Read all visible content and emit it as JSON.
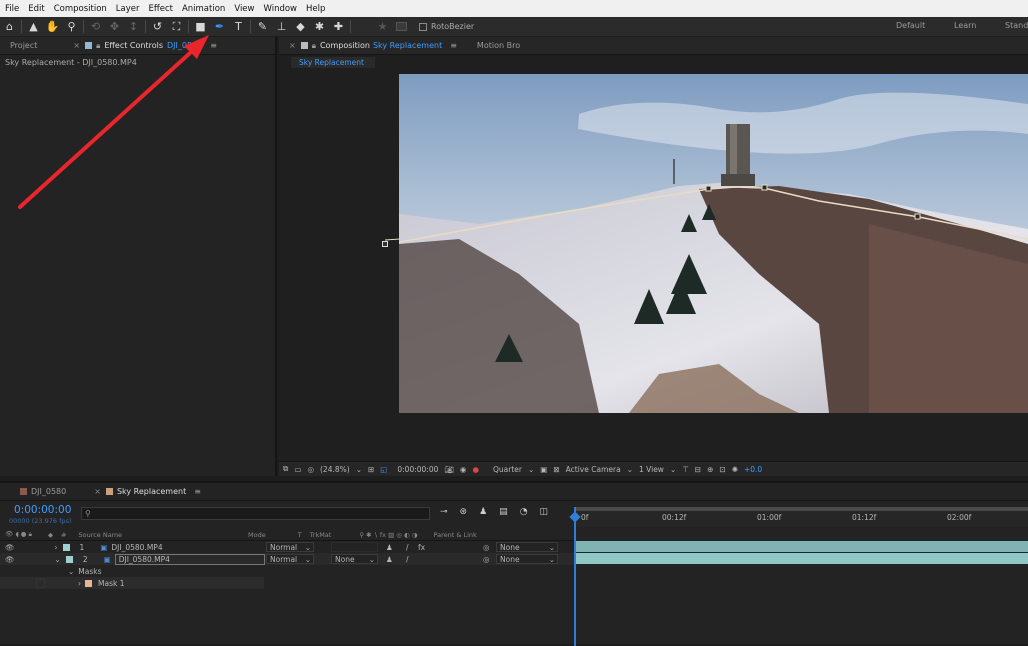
{
  "menu": [
    "File",
    "Edit",
    "Composition",
    "Layer",
    "Effect",
    "Animation",
    "View",
    "Window",
    "Help"
  ],
  "toolbar": {
    "tools": [
      "home-icon",
      "selection-icon",
      "hand-icon",
      "zoom-icon",
      "orbit-icon",
      "move-icon",
      "pan-icon",
      "rotate-icon",
      "anchor-icon",
      "rectangle-icon",
      "pen-icon",
      "type-icon",
      "brush-icon",
      "clone-stamp-icon",
      "eraser-icon",
      "roto-brush-icon",
      "puppet-icon"
    ],
    "rotobezier_label": "RotoBezier",
    "workspaces": [
      "Default",
      "Learn",
      "Standa"
    ]
  },
  "left_panel": {
    "tab_project": "Project",
    "tab_effect_controls": "Effect Controls",
    "tab_effect_target": "DJI_0580",
    "subtitle": "Sky Replacement - DJI_0580.MP4"
  },
  "comp_panel": {
    "tab_label": "Composition",
    "tab_name": "Sky Replacement",
    "other_tab": "Motion Bro",
    "breadcrumb": "Sky Replacement",
    "footer": {
      "zoom": "(24.8%)",
      "timecode": "0:00:00:00",
      "resolution": "Quarter",
      "camera": "Active Camera",
      "views": "1 View",
      "exposure": "+0.0"
    }
  },
  "timeline": {
    "tab1": "DJI_0580",
    "tab2": "Sky Replacement",
    "timecode": "0:00:00:00",
    "frames": "00000 (23.976 fps)",
    "search_placeholder": "",
    "headers": {
      "source": "Source Name",
      "mode": "Mode",
      "t": "T",
      "trkmat": "TrkMat",
      "parent": "Parent & Link",
      "num": "#"
    },
    "ruler": [
      "0f",
      "00:12f",
      "01:00f",
      "01:12f",
      "02:00f"
    ],
    "layers": [
      {
        "num": "1",
        "name": "DJI_0580.MP4",
        "mode": "Normal",
        "trkmat": "",
        "parent": "None"
      },
      {
        "num": "2",
        "name": "DJI_0580.MP4",
        "mode": "Normal",
        "trkmat": "None",
        "parent": "None"
      }
    ],
    "masks_label": "Masks",
    "mask1_label": "Mask 1"
  },
  "colors": {
    "accent": "#3f9bff",
    "arrow": "#e8262c",
    "panel": "#1d1d1d",
    "layer_bar": "#7fb3b4"
  }
}
